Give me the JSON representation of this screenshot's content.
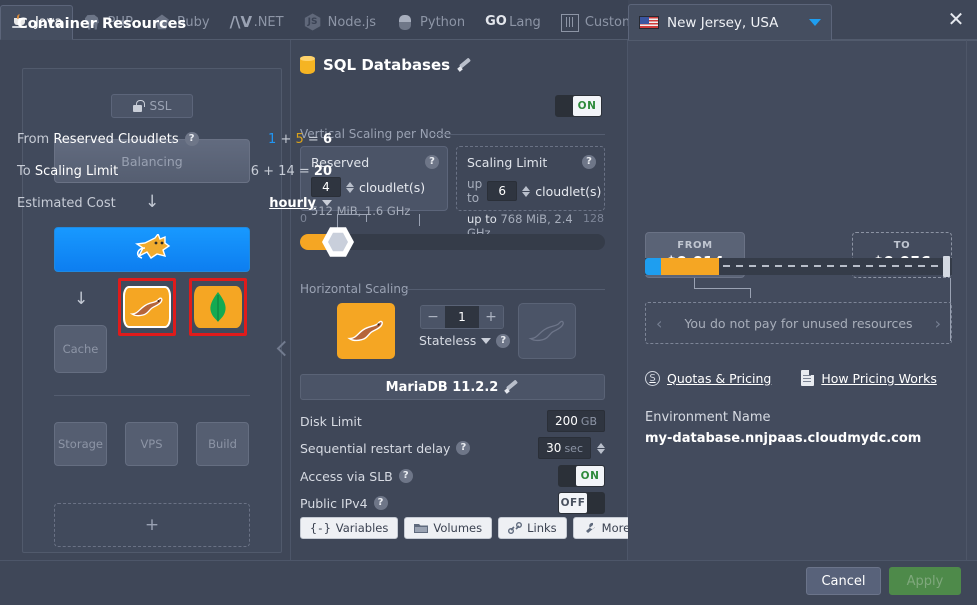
{
  "tabs": [
    {
      "label": "Java",
      "icon": "java-icon",
      "active": true
    },
    {
      "label": "PHP",
      "icon": "php-elephant-icon",
      "active": false
    },
    {
      "label": "Ruby",
      "icon": "ruby-gem-icon",
      "active": false
    },
    {
      "label": ".NET",
      "icon": "dotnet-icon",
      "active": false
    },
    {
      "label": "Node.js",
      "icon": "nodejs-hexagon-icon",
      "active": false
    },
    {
      "label": "Python",
      "icon": "python-icon",
      "active": false
    },
    {
      "label": "Lang",
      "icon": "go-lang-icon",
      "active": false
    },
    {
      "label": "Custom",
      "icon": "custom-bars-icon",
      "active": false
    }
  ],
  "region": {
    "name": "New Jersey, USA",
    "flag_icon": "usa-flag-icon",
    "caret_icon": "chevron-down-icon",
    "close_icon": "close-icon"
  },
  "topology": {
    "ssl_label": "SSL",
    "ssl_icon": "unlocked-padlock-icon",
    "balancing_label": "Balancing",
    "tomcat_icon": "tomcat-cat-icon",
    "cache_label": "Cache",
    "mariadb_icon": "mariadb-seal-icon",
    "mongodb_icon": "mongodb-leaf-icon",
    "storage_label": "Storage",
    "vps_label": "VPS",
    "build_label": "Build",
    "add_label": "+",
    "arrow_icon": "arrow-down-icon",
    "collapse_icon": "chevron-left-icon",
    "selection_color": "#e01b1b"
  },
  "middle": {
    "title": "SQL Databases",
    "title_icon": "database-cylinder-icon",
    "edit_icon": "pencil-icon",
    "power_toggle": "ON",
    "vertical_section": "Vertical Scaling per Node",
    "reserved": {
      "caption": "Reserved",
      "value": "4",
      "unit": "cloudlet(s)",
      "sub": "512 MiB, 1.6 GHz",
      "help_icon": "question-mark-icon"
    },
    "scaling_limit": {
      "caption": "Scaling Limit",
      "prefix": "up to",
      "value": "6",
      "unit": "cloudlet(s)",
      "sub_prefix": "up to",
      "sub": "768 MiB, 2.4 GHz",
      "help_icon": "question-mark-icon"
    },
    "slider": {
      "min": "0",
      "max": "128"
    },
    "horizontal_section": "Horizontal Scaling",
    "node_count": "1",
    "minus_label": "−",
    "plus_label": "+",
    "stateless_label": "Stateless",
    "stateless_caret": "chevron-down-icon",
    "stack_label": "MariaDB 11.2.2",
    "options": [
      {
        "label": "Disk Limit",
        "value": "200",
        "unit": "GB",
        "type": "value",
        "help": false
      },
      {
        "label": "Sequential restart delay",
        "value": "30",
        "unit": "sec",
        "type": "spinner",
        "help": true
      },
      {
        "label": "Access via SLB",
        "value": "ON",
        "type": "toggle",
        "help": true
      },
      {
        "label": "Public IPv4",
        "value": "OFF",
        "type": "toggle-off",
        "help": true
      }
    ],
    "buttons": [
      {
        "label": "Variables",
        "icon": "braces-icon"
      },
      {
        "label": "Volumes",
        "icon": "folder-icon"
      },
      {
        "label": "Links",
        "icon": "chain-link-icon"
      },
      {
        "label": "More",
        "icon": "wrench-icon"
      }
    ]
  },
  "right": {
    "title": "Container Resources",
    "rows": [
      {
        "key_plain": "From ",
        "key_bold": "Reserved Cloudlets",
        "help_icon": "question-mark-icon",
        "v1": "1",
        "op1": "+",
        "v2": "5",
        "eq": "=",
        "total": "6",
        "highlight": true
      },
      {
        "key_plain": "To ",
        "key_bold": "Scaling Limit",
        "help_icon": "",
        "v1": "6",
        "op1": "+",
        "v2": "14",
        "eq": "=",
        "total": "20",
        "highlight": false
      }
    ],
    "estimated_cost_label": "Estimated Cost",
    "period": "hourly",
    "period_caret": "chevron-down-icon",
    "from_card": {
      "caption": "FROM",
      "amount": "$0.014"
    },
    "to_card": {
      "caption": "TO",
      "amount": "$0.056"
    },
    "unused_note": "You do not pay for unused resources",
    "prev_icon": "chevron-left-icon",
    "next_icon": "chevron-right-icon",
    "links": [
      {
        "label": "Quotas & Pricing",
        "icon": "dollar-circle-icon"
      },
      {
        "label": "How Pricing Works",
        "icon": "document-icon"
      }
    ],
    "env_name_label": "Environment Name",
    "env_name_value": "my-database.nnjpaas.cloudmydc.com",
    "colors": {
      "blue": "#2196f3",
      "orange": "#f5a623",
      "accent_red": "#e01b1b"
    }
  },
  "footer": {
    "cancel_label": "Cancel",
    "apply_label": "Apply"
  }
}
